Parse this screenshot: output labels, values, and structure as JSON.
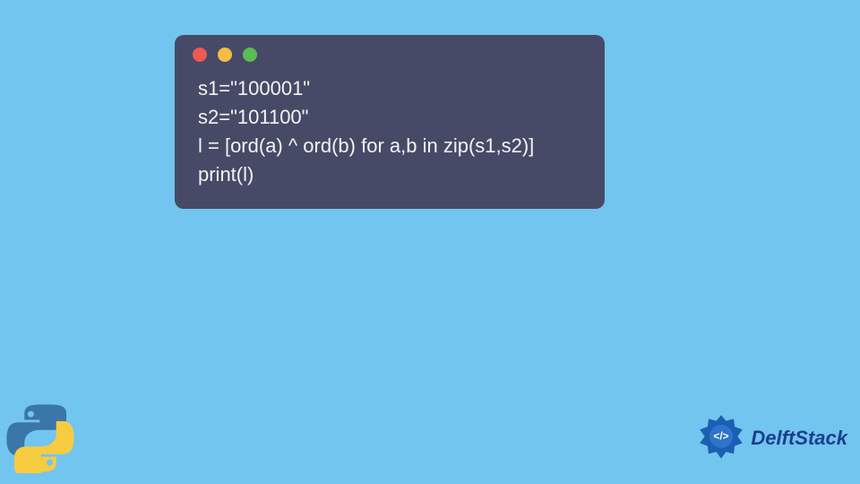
{
  "code": {
    "lines": [
      "s1=\"100001\"",
      "s2=\"101100\"",
      "l = [ord(a) ^ ord(b) for a,b in zip(s1,s2)]",
      "print(l)"
    ]
  },
  "window": {
    "buttons": [
      "close",
      "minimize",
      "maximize"
    ]
  },
  "branding": {
    "site_name": "DelftStack",
    "left_icon": "python-logo",
    "right_icon": "delftstack-logo"
  },
  "colors": {
    "background": "#72c5ee",
    "window_bg": "#474A67",
    "code_text": "#F3F3F3",
    "dot_red": "#EC5A53",
    "dot_yellow": "#F6BD44",
    "dot_green": "#5ABD57",
    "brand_text": "#1B3E8C",
    "python_blue": "#3A76A8",
    "python_yellow": "#F7CC40"
  }
}
